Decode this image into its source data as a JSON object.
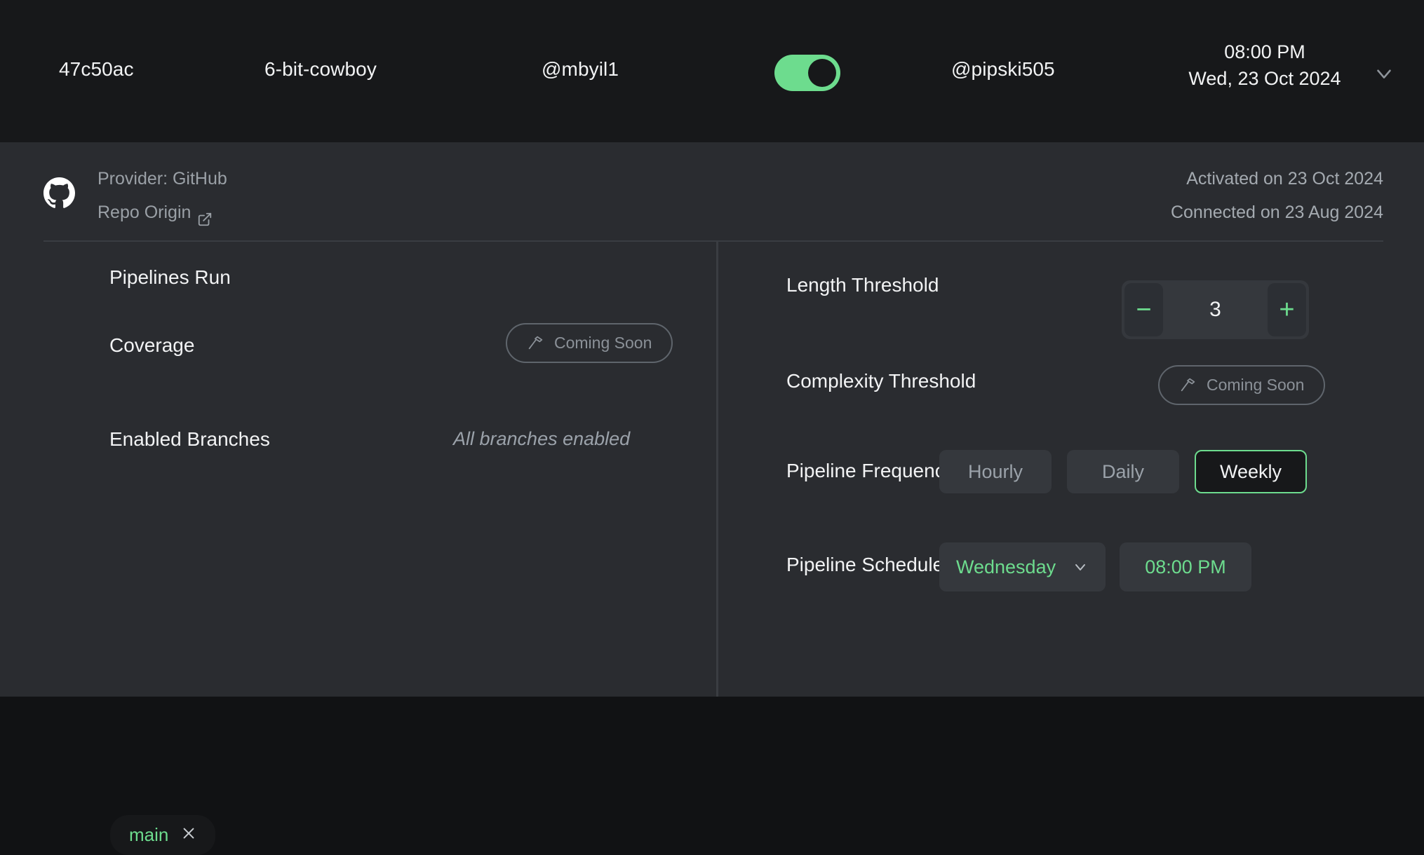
{
  "header": {
    "commit": "47c50ac",
    "repo": "6-bit-cowboy",
    "user_primary": "@mbyil1",
    "user_secondary": "@pipski505",
    "toggle_state": "on",
    "time": "08:00 PM",
    "date": "Wed, 23 Oct 2024",
    "expand_icon": "chevron-down-icon",
    "background": "#17181a"
  },
  "provider": {
    "icon": "github-icon",
    "provider_line": "Provider: GitHub",
    "repo_origin_label": "Repo Origin",
    "repo_origin_icon": "external-link-icon",
    "activated": "Activated on 23 Oct 2024",
    "connected": "Connected on 23 Aug 2024"
  },
  "left_column": {
    "pipelines_run_label": "Pipelines Run",
    "coverage_label": "Coverage",
    "coverage_badge": {
      "icon": "hammer-icon",
      "label": "Coming Soon"
    },
    "enabled_branches_label": "Enabled Branches",
    "all_branches_text": "All branches enabled",
    "branch_chips": [
      {
        "name": "main",
        "close_icon": "close-icon"
      }
    ]
  },
  "right_column": {
    "length_threshold": {
      "label": "Length Threshold",
      "decrement": "−",
      "value": "3",
      "increment": "+"
    },
    "complexity_threshold": {
      "label": "Complexity Threshold",
      "badge": {
        "icon": "hammer-icon",
        "label": "Coming Soon"
      }
    },
    "pipeline_frequency": {
      "label": "Pipeline Frequency",
      "options": [
        "Hourly",
        "Daily",
        "Weekly"
      ],
      "selected": "Weekly"
    },
    "pipeline_schedule": {
      "label": "Pipeline Schedule",
      "day": "Wednesday",
      "day_chevron": "chevron-down-icon",
      "time": "08:00 PM"
    }
  },
  "colors": {
    "accent_green": "#6ddc8e",
    "card_bg": "#2a2c30",
    "header_bg": "#17181a",
    "control_bg": "#35383d",
    "divider": "#3a3d42",
    "text_primary": "#f2f3f4",
    "text_muted": "#9ba2aa"
  }
}
